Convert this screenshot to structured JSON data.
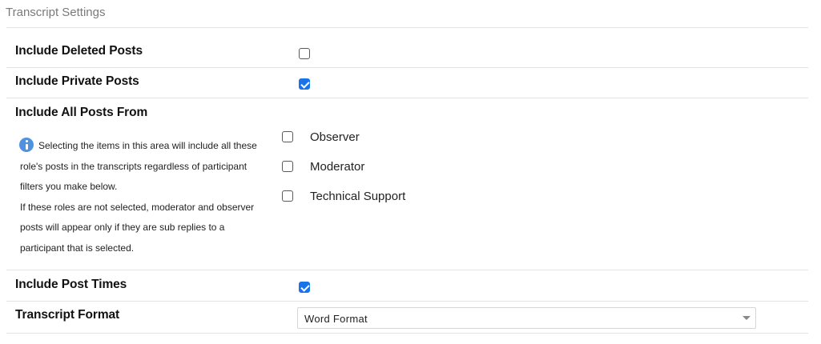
{
  "section": {
    "title": "Transcript Settings"
  },
  "rows": {
    "include_deleted": {
      "label": "Include Deleted Posts",
      "checked": false
    },
    "include_private": {
      "label": "Include Private Posts",
      "checked": true
    },
    "include_all_from": {
      "label": "Include All Posts From",
      "info_lines": [
        "Selecting the items in this area will include all these",
        "role's posts in the transcripts regardless of participant",
        "filters you make below.",
        "If these roles are not selected, moderator and observer",
        "posts will appear only if they are sub replies to a",
        "participant that is selected."
      ],
      "options": [
        {
          "label": "Observer",
          "checked": false
        },
        {
          "label": "Moderator",
          "checked": false
        },
        {
          "label": "Technical Support",
          "checked": false
        }
      ]
    },
    "include_post_times": {
      "label": "Include Post Times",
      "checked": true
    },
    "transcript_format": {
      "label": "Transcript Format",
      "selected": "Word Format"
    }
  },
  "colors": {
    "accent": "#1a73e8",
    "info_icon": "#4f92e0",
    "divider": "#e3e3e3"
  },
  "icons": {
    "info": "info-icon",
    "dropdown": "chevron-down-icon"
  }
}
